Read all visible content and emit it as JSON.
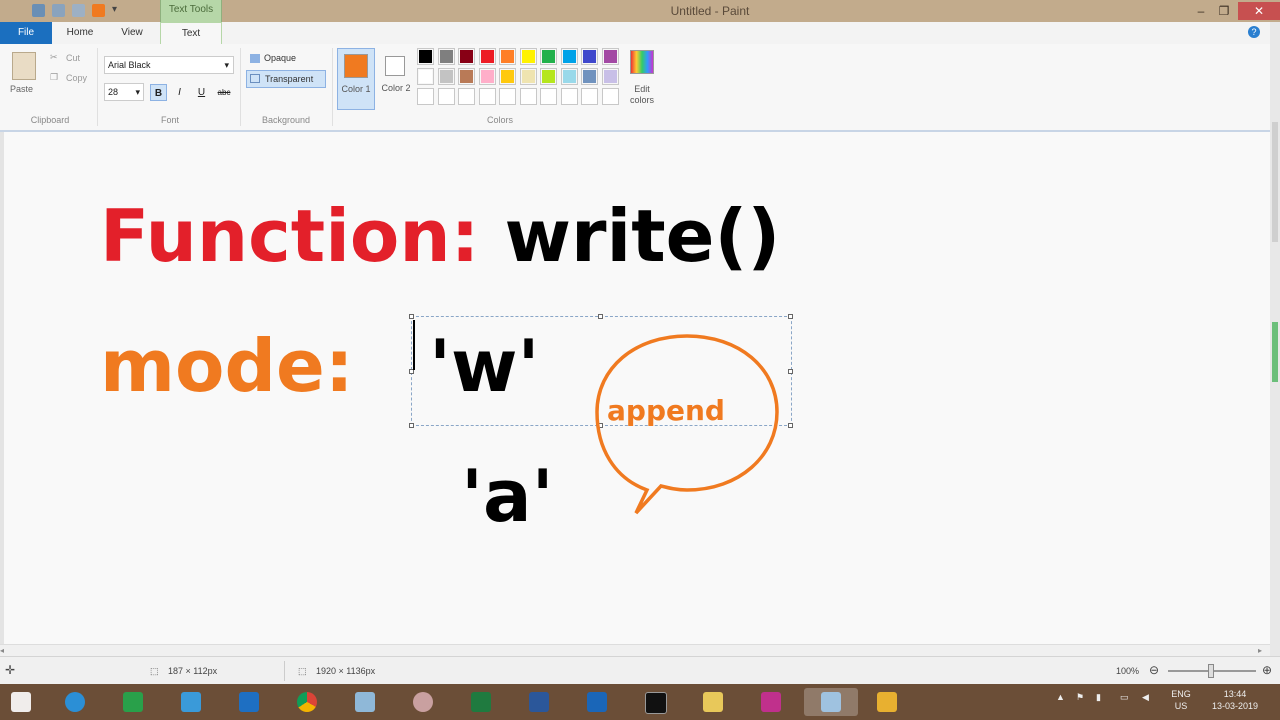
{
  "window": {
    "title": "Untitled - Paint",
    "contextual_tab": "Text Tools",
    "controls": {
      "minimize": "–",
      "restore": "❐",
      "close": "✕"
    }
  },
  "tabs": {
    "file": "File",
    "home": "Home",
    "view": "View",
    "text": "Text"
  },
  "clipboard": {
    "paste": "Paste",
    "cut": "Cut",
    "copy": "Copy",
    "group": "Clipboard"
  },
  "font": {
    "family": "Arial Black",
    "size": "28",
    "bold": "B",
    "italic": "I",
    "underline": "U",
    "strike": "abc",
    "group": "Font"
  },
  "background": {
    "opaque": "Opaque",
    "transparent": "Transparent",
    "group": "Background"
  },
  "colors": {
    "color1": "Color 1",
    "color2": "Color 2",
    "edit": "Edit colors",
    "group": "Colors",
    "color1_value": "#f07a20",
    "color2_value": "#ffffff",
    "palette_row1": [
      "#000000",
      "#7f7f7f",
      "#880015",
      "#ed1c24",
      "#ff7f27",
      "#fff200",
      "#22b14c",
      "#00a2e8",
      "#3f48cc",
      "#a349a4"
    ],
    "palette_row2": [
      "#ffffff",
      "#c3c3c3",
      "#b97a57",
      "#ffaec9",
      "#ffc90e",
      "#efe4b0",
      "#b5e61d",
      "#99d9ea",
      "#7092be",
      "#c8bfe7"
    ]
  },
  "canvas": {
    "line1_red": "Function:",
    "line1_black": "write()",
    "line2_orange": "mode:",
    "w_text": "'w'",
    "a_text": "'a'",
    "bubble_text": "append",
    "red": "#e3202a",
    "orange": "#f07a20"
  },
  "status": {
    "selection": "187 × 112px",
    "canvas_size": "1920 × 1136px",
    "zoom": "100%"
  },
  "tray": {
    "lang": "ENG",
    "region": "US",
    "time": "13:44",
    "date": "13-03-2019"
  },
  "taskbar": {
    "apps": [
      "windows-start",
      "internet-explorer",
      "store",
      "computer",
      "remote-desktop",
      "chrome",
      "notepad",
      "paint-tool",
      "excel",
      "word",
      "outlook",
      "cmd",
      "explorer-folder",
      "camera",
      "paint",
      "network-app"
    ]
  }
}
